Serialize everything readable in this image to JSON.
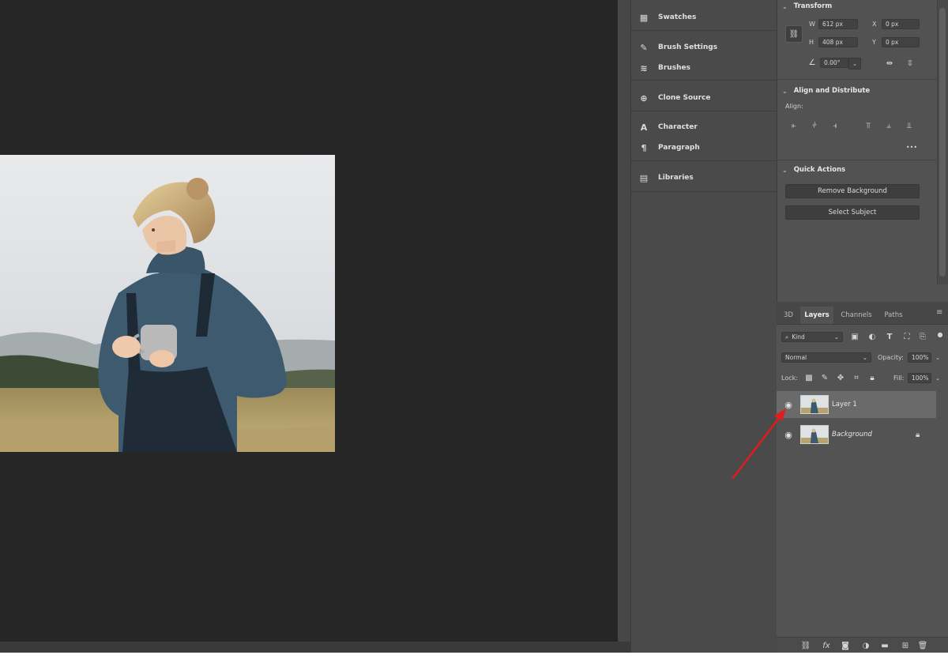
{
  "panels_mid": [
    {
      "label": "Swatches",
      "icon": "swatches-icon",
      "glyph": "▦"
    },
    {
      "label": "Brush Settings",
      "icon": "brush-settings-icon",
      "glyph": "✎"
    },
    {
      "label": "Brushes",
      "icon": "brushes-icon",
      "glyph": "≋"
    },
    {
      "label": "Clone Source",
      "icon": "clone-source-icon",
      "glyph": "⊕"
    },
    {
      "label": "Character",
      "icon": "character-icon",
      "glyph": "A"
    },
    {
      "label": "Paragraph",
      "icon": "paragraph-icon",
      "glyph": "¶"
    },
    {
      "label": "Libraries",
      "icon": "libraries-icon",
      "glyph": "▤"
    }
  ],
  "properties": {
    "transform": {
      "title": "Transform",
      "w_label": "W",
      "w_value": "612 px",
      "h_label": "H",
      "h_value": "408 px",
      "x_label": "X",
      "x_value": "0 px",
      "y_label": "Y",
      "y_value": "0 px",
      "angle": "0.00°"
    },
    "align": {
      "title": "Align and Distribute",
      "subtitle": "Align:",
      "more": "•••"
    },
    "quick_actions": {
      "title": "Quick Actions",
      "remove_bg": "Remove Background",
      "select_subject": "Select Subject"
    }
  },
  "layers_panel": {
    "tabs": [
      "3D",
      "Layers",
      "Channels",
      "Paths"
    ],
    "active_tab": "Layers",
    "kind_label": "Kind",
    "blend_mode": "Normal",
    "opacity_label": "Opacity:",
    "opacity_value": "100%",
    "lock_label": "Lock:",
    "fill_label": "Fill:",
    "fill_value": "100%",
    "layers": [
      {
        "name": "Layer 1",
        "visible": true,
        "selected": true,
        "locked": false,
        "italic": false
      },
      {
        "name": "Background",
        "visible": true,
        "selected": false,
        "locked": true,
        "italic": true
      }
    ]
  },
  "colors": {
    "canvas": "#262626",
    "panel": "#4a4a4a",
    "panel_right": "#525252",
    "selected_layer": "#6a6a6a",
    "arrow": "#e01c1c"
  }
}
